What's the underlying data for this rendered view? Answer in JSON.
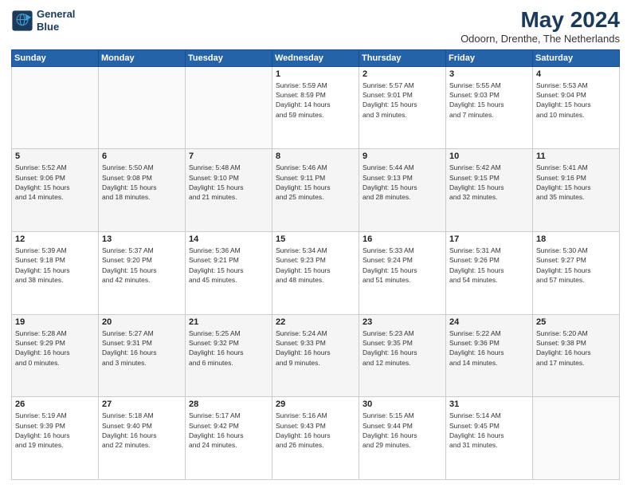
{
  "logo": {
    "line1": "General",
    "line2": "Blue"
  },
  "title": "May 2024",
  "subtitle": "Odoorn, Drenthe, The Netherlands",
  "days_header": [
    "Sunday",
    "Monday",
    "Tuesday",
    "Wednesday",
    "Thursday",
    "Friday",
    "Saturday"
  ],
  "weeks": [
    [
      {
        "num": "",
        "info": ""
      },
      {
        "num": "",
        "info": ""
      },
      {
        "num": "",
        "info": ""
      },
      {
        "num": "1",
        "info": "Sunrise: 5:59 AM\nSunset: 8:59 PM\nDaylight: 14 hours\nand 59 minutes."
      },
      {
        "num": "2",
        "info": "Sunrise: 5:57 AM\nSunset: 9:01 PM\nDaylight: 15 hours\nand 3 minutes."
      },
      {
        "num": "3",
        "info": "Sunrise: 5:55 AM\nSunset: 9:03 PM\nDaylight: 15 hours\nand 7 minutes."
      },
      {
        "num": "4",
        "info": "Sunrise: 5:53 AM\nSunset: 9:04 PM\nDaylight: 15 hours\nand 10 minutes."
      }
    ],
    [
      {
        "num": "5",
        "info": "Sunrise: 5:52 AM\nSunset: 9:06 PM\nDaylight: 15 hours\nand 14 minutes."
      },
      {
        "num": "6",
        "info": "Sunrise: 5:50 AM\nSunset: 9:08 PM\nDaylight: 15 hours\nand 18 minutes."
      },
      {
        "num": "7",
        "info": "Sunrise: 5:48 AM\nSunset: 9:10 PM\nDaylight: 15 hours\nand 21 minutes."
      },
      {
        "num": "8",
        "info": "Sunrise: 5:46 AM\nSunset: 9:11 PM\nDaylight: 15 hours\nand 25 minutes."
      },
      {
        "num": "9",
        "info": "Sunrise: 5:44 AM\nSunset: 9:13 PM\nDaylight: 15 hours\nand 28 minutes."
      },
      {
        "num": "10",
        "info": "Sunrise: 5:42 AM\nSunset: 9:15 PM\nDaylight: 15 hours\nand 32 minutes."
      },
      {
        "num": "11",
        "info": "Sunrise: 5:41 AM\nSunset: 9:16 PM\nDaylight: 15 hours\nand 35 minutes."
      }
    ],
    [
      {
        "num": "12",
        "info": "Sunrise: 5:39 AM\nSunset: 9:18 PM\nDaylight: 15 hours\nand 38 minutes."
      },
      {
        "num": "13",
        "info": "Sunrise: 5:37 AM\nSunset: 9:20 PM\nDaylight: 15 hours\nand 42 minutes."
      },
      {
        "num": "14",
        "info": "Sunrise: 5:36 AM\nSunset: 9:21 PM\nDaylight: 15 hours\nand 45 minutes."
      },
      {
        "num": "15",
        "info": "Sunrise: 5:34 AM\nSunset: 9:23 PM\nDaylight: 15 hours\nand 48 minutes."
      },
      {
        "num": "16",
        "info": "Sunrise: 5:33 AM\nSunset: 9:24 PM\nDaylight: 15 hours\nand 51 minutes."
      },
      {
        "num": "17",
        "info": "Sunrise: 5:31 AM\nSunset: 9:26 PM\nDaylight: 15 hours\nand 54 minutes."
      },
      {
        "num": "18",
        "info": "Sunrise: 5:30 AM\nSunset: 9:27 PM\nDaylight: 15 hours\nand 57 minutes."
      }
    ],
    [
      {
        "num": "19",
        "info": "Sunrise: 5:28 AM\nSunset: 9:29 PM\nDaylight: 16 hours\nand 0 minutes."
      },
      {
        "num": "20",
        "info": "Sunrise: 5:27 AM\nSunset: 9:31 PM\nDaylight: 16 hours\nand 3 minutes."
      },
      {
        "num": "21",
        "info": "Sunrise: 5:25 AM\nSunset: 9:32 PM\nDaylight: 16 hours\nand 6 minutes."
      },
      {
        "num": "22",
        "info": "Sunrise: 5:24 AM\nSunset: 9:33 PM\nDaylight: 16 hours\nand 9 minutes."
      },
      {
        "num": "23",
        "info": "Sunrise: 5:23 AM\nSunset: 9:35 PM\nDaylight: 16 hours\nand 12 minutes."
      },
      {
        "num": "24",
        "info": "Sunrise: 5:22 AM\nSunset: 9:36 PM\nDaylight: 16 hours\nand 14 minutes."
      },
      {
        "num": "25",
        "info": "Sunrise: 5:20 AM\nSunset: 9:38 PM\nDaylight: 16 hours\nand 17 minutes."
      }
    ],
    [
      {
        "num": "26",
        "info": "Sunrise: 5:19 AM\nSunset: 9:39 PM\nDaylight: 16 hours\nand 19 minutes."
      },
      {
        "num": "27",
        "info": "Sunrise: 5:18 AM\nSunset: 9:40 PM\nDaylight: 16 hours\nand 22 minutes."
      },
      {
        "num": "28",
        "info": "Sunrise: 5:17 AM\nSunset: 9:42 PM\nDaylight: 16 hours\nand 24 minutes."
      },
      {
        "num": "29",
        "info": "Sunrise: 5:16 AM\nSunset: 9:43 PM\nDaylight: 16 hours\nand 26 minutes."
      },
      {
        "num": "30",
        "info": "Sunrise: 5:15 AM\nSunset: 9:44 PM\nDaylight: 16 hours\nand 29 minutes."
      },
      {
        "num": "31",
        "info": "Sunrise: 5:14 AM\nSunset: 9:45 PM\nDaylight: 16 hours\nand 31 minutes."
      },
      {
        "num": "",
        "info": ""
      }
    ]
  ]
}
